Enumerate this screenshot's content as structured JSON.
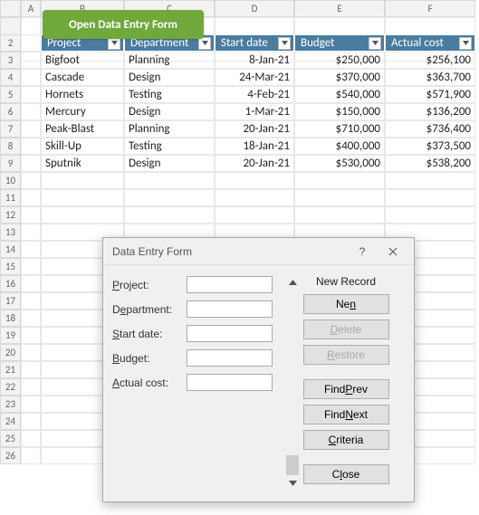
{
  "columns": [
    "A",
    "B",
    "C",
    "D",
    "E",
    "F"
  ],
  "button": {
    "label": "Open Data Entry Form"
  },
  "table": {
    "headers": [
      "Project",
      "Department",
      "Start date",
      "Budget",
      "Actual cost"
    ],
    "rows": [
      {
        "p": "Bigfoot",
        "d": "Planning",
        "s": "8-Jan-21",
        "b": "$250,000",
        "a": "$256,100"
      },
      {
        "p": "Cascade",
        "d": "Design",
        "s": "24-Mar-21",
        "b": "$370,000",
        "a": "$363,700"
      },
      {
        "p": "Hornets",
        "d": "Testing",
        "s": "4-Feb-21",
        "b": "$540,000",
        "a": "$571,900"
      },
      {
        "p": "Mercury",
        "d": "Design",
        "s": "1-Mar-21",
        "b": "$150,000",
        "a": "$136,200"
      },
      {
        "p": "Peak-Blast",
        "d": "Planning",
        "s": "20-Jan-21",
        "b": "$710,000",
        "a": "$736,400"
      },
      {
        "p": "Skill-Up",
        "d": "Testing",
        "s": "18-Jan-21",
        "b": "$400,000",
        "a": "$373,500"
      },
      {
        "p": "Sputnik",
        "d": "Design",
        "s": "20-Jan-21",
        "b": "$530,000",
        "a": "$538,200"
      }
    ]
  },
  "dialog": {
    "title": "Data Entry Form",
    "help": "?",
    "fields": {
      "project": "Project:",
      "department": "Department:",
      "start": "Start date:",
      "budget": "Budget:",
      "actual": "Actual cost:"
    },
    "status": "New Record",
    "buttons": {
      "new": "New",
      "delete": "Delete",
      "restore": "Restore",
      "findprev": "Find Prev",
      "findnext": "Find Next",
      "criteria": "Criteria",
      "close": "Close"
    }
  },
  "ul": {
    "n": "N",
    "d": "D",
    "r": "R",
    "p": "P",
    "x": "N",
    "c": "C",
    "l": "l",
    "proj": "P",
    "dep": "D",
    "st": "S",
    "bud": "B",
    "act": "A"
  }
}
